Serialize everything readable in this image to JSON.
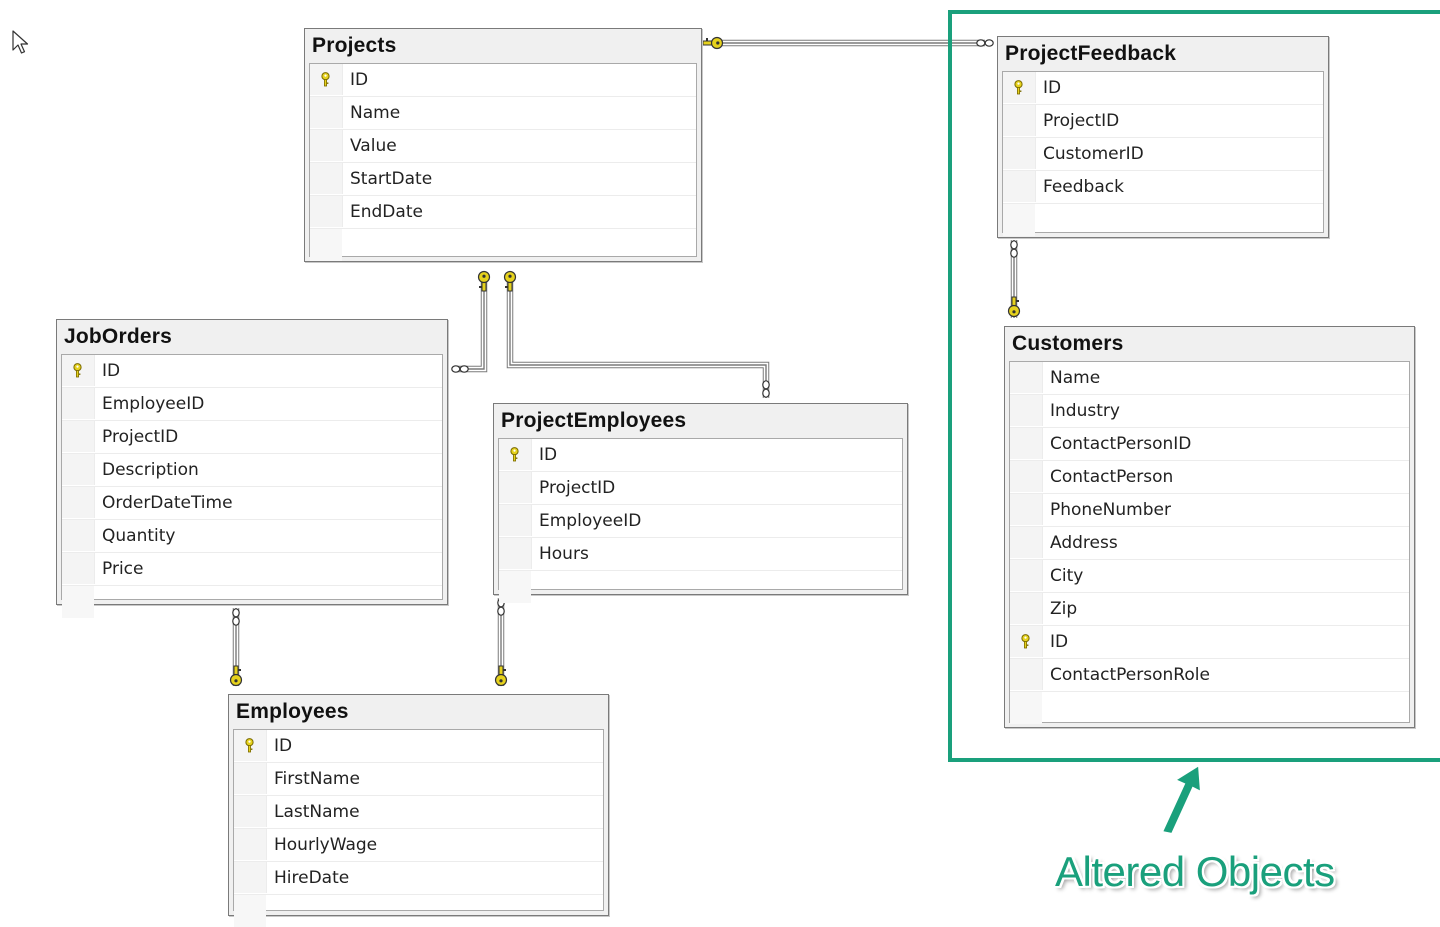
{
  "colors": {
    "key": "#e6d21c",
    "key_outline": "#7a6a00",
    "connector": "#7a7a7a",
    "highlight": "#1aa07c"
  },
  "tables": {
    "projects": {
      "title": "Projects",
      "columns": [
        {
          "name": "ID",
          "is_key": true
        },
        {
          "name": "Name",
          "is_key": false
        },
        {
          "name": "Value",
          "is_key": false
        },
        {
          "name": "StartDate",
          "is_key": false
        },
        {
          "name": "EndDate",
          "is_key": false
        }
      ]
    },
    "project_feedback": {
      "title": "ProjectFeedback",
      "columns": [
        {
          "name": "ID",
          "is_key": true
        },
        {
          "name": "ProjectID",
          "is_key": false
        },
        {
          "name": "CustomerID",
          "is_key": false
        },
        {
          "name": "Feedback",
          "is_key": false
        }
      ]
    },
    "job_orders": {
      "title": "JobOrders",
      "columns": [
        {
          "name": "ID",
          "is_key": true
        },
        {
          "name": "EmployeeID",
          "is_key": false
        },
        {
          "name": "ProjectID",
          "is_key": false
        },
        {
          "name": "Description",
          "is_key": false
        },
        {
          "name": "OrderDateTime",
          "is_key": false
        },
        {
          "name": "Quantity",
          "is_key": false
        },
        {
          "name": "Price",
          "is_key": false
        }
      ]
    },
    "project_employees": {
      "title": "ProjectEmployees",
      "columns": [
        {
          "name": "ID",
          "is_key": true
        },
        {
          "name": "ProjectID",
          "is_key": false
        },
        {
          "name": "EmployeeID",
          "is_key": false
        },
        {
          "name": "Hours",
          "is_key": false
        }
      ]
    },
    "customers": {
      "title": "Customers",
      "columns": [
        {
          "name": "Name",
          "is_key": false
        },
        {
          "name": "Industry",
          "is_key": false
        },
        {
          "name": "ContactPersonID",
          "is_key": false
        },
        {
          "name": "ContactPerson",
          "is_key": false
        },
        {
          "name": "PhoneNumber",
          "is_key": false
        },
        {
          "name": "Address",
          "is_key": false
        },
        {
          "name": "City",
          "is_key": false
        },
        {
          "name": "Zip",
          "is_key": false
        },
        {
          "name": "ID",
          "is_key": true
        },
        {
          "name": "ContactPersonRole",
          "is_key": false
        }
      ]
    },
    "employees": {
      "title": "Employees",
      "columns": [
        {
          "name": "ID",
          "is_key": true
        },
        {
          "name": "FirstName",
          "is_key": false
        },
        {
          "name": "LastName",
          "is_key": false
        },
        {
          "name": "HourlyWage",
          "is_key": false
        },
        {
          "name": "HireDate",
          "is_key": false
        }
      ]
    }
  },
  "relationships": [
    {
      "one": "projects",
      "many": "project_feedback"
    },
    {
      "one": "projects",
      "many": "job_orders"
    },
    {
      "one": "projects",
      "many": "project_employees"
    },
    {
      "one": "customers",
      "many": "project_feedback"
    },
    {
      "one": "employees",
      "many": "job_orders"
    },
    {
      "one": "employees",
      "many": "project_employees"
    }
  ],
  "annotation": {
    "label": "Altered Objects",
    "arrow_icon": "arrow-up-icon"
  }
}
